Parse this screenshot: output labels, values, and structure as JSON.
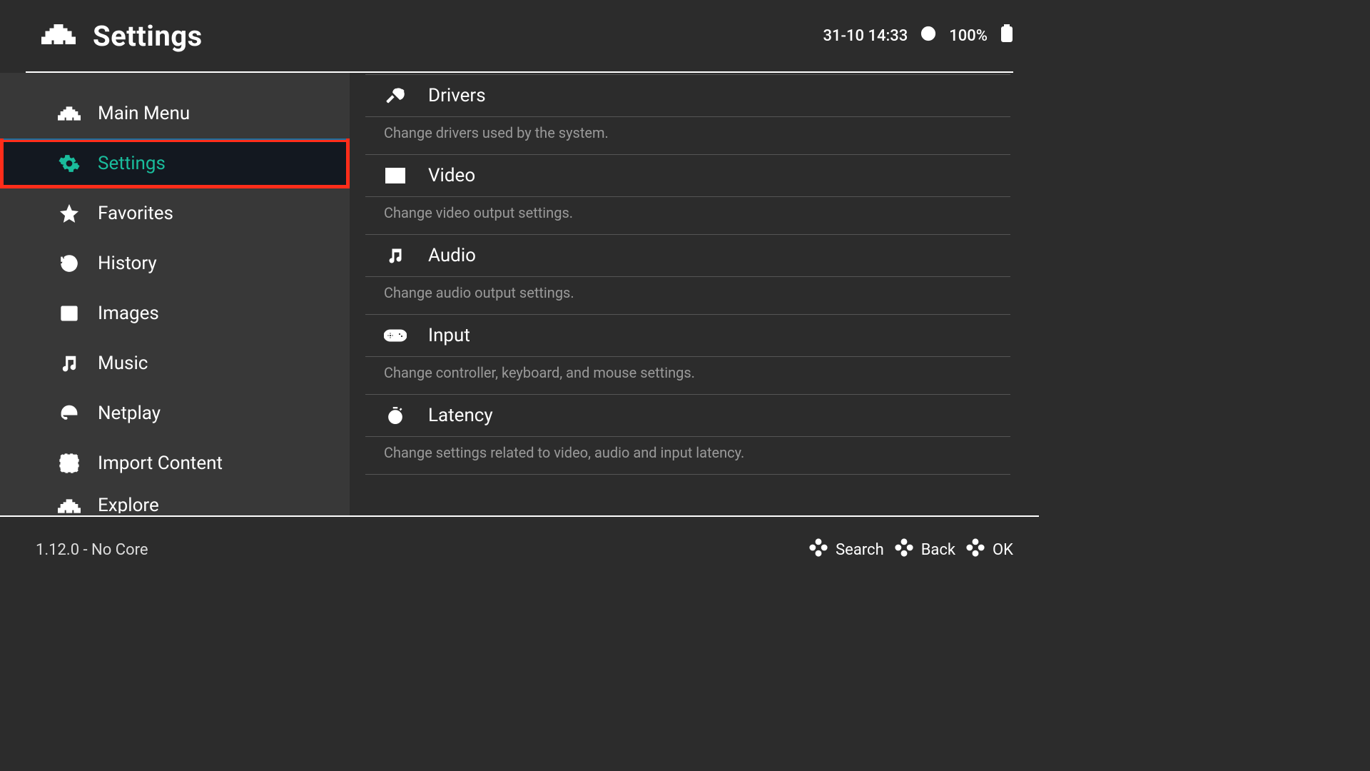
{
  "header": {
    "title": "Settings",
    "datetime": "31-10 14:33",
    "battery": "100%"
  },
  "sidebar": {
    "items": [
      {
        "label": "Main Menu"
      },
      {
        "label": "Settings"
      },
      {
        "label": "Favorites"
      },
      {
        "label": "History"
      },
      {
        "label": "Images"
      },
      {
        "label": "Music"
      },
      {
        "label": "Netplay"
      },
      {
        "label": "Import Content"
      },
      {
        "label": "Explore"
      }
    ]
  },
  "settings": [
    {
      "title": "Drivers",
      "desc": "Change drivers used by the system."
    },
    {
      "title": "Video",
      "desc": "Change video output settings."
    },
    {
      "title": "Audio",
      "desc": "Change audio output settings."
    },
    {
      "title": "Input",
      "desc": "Change controller, keyboard, and mouse settings."
    },
    {
      "title": "Latency",
      "desc": "Change settings related to video, audio and input latency."
    }
  ],
  "footer": {
    "version": "1.12.0 - No Core",
    "actions": {
      "search": "Search",
      "back": "Back",
      "ok": "OK"
    }
  }
}
